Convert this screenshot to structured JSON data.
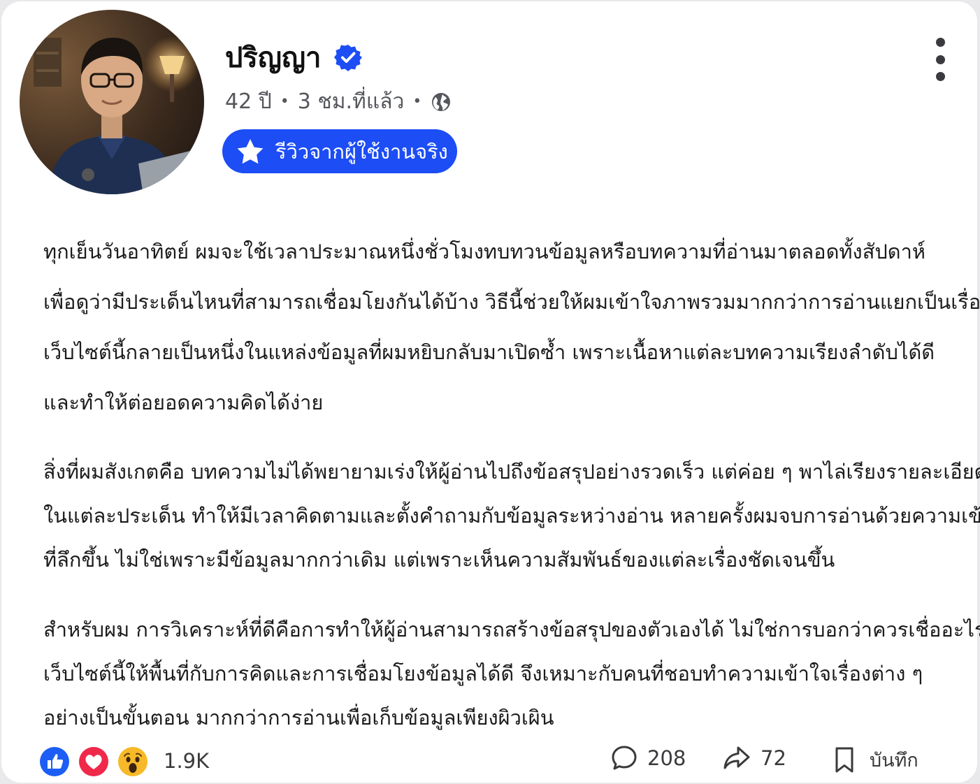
{
  "post": {
    "author": {
      "name": "ปริญญา",
      "verified": true,
      "avatar_icon": "person-photo"
    },
    "meta": {
      "age": "42 ปี",
      "time": "3 ชม.ที่แล้ว",
      "separator": "•",
      "audience_icon": "globe-icon"
    },
    "badge": {
      "icon": "star-icon",
      "label": "รีวิวจากผู้ใช้งานจริง",
      "color": "#1c4df5"
    },
    "menu_icon": "more-vertical-icon",
    "paragraphs": [
      {
        "lines": [
          "ทุกเย็นวันอาทิตย์ ผมจะใช้เวลาประมาณหนึ่งชั่วโมงทบทวนข้อมูลหรือบทความที่อ่านมาตลอดทั้งสัปดาห์",
          "เพื่อดูว่ามีประเด็นไหนที่สามารถเชื่อมโยงกันได้บ้าง วิธีนี้ช่วยให้ผมเข้าใจภาพรวมมากกว่าการอ่านแยกเป็นเรื่อง ๆ",
          "เว็บไซต์นี้กลายเป็นหนึ่งในแหล่งข้อมูลที่ผมหยิบกลับมาเปิดซ้ำ เพราะเนื้อหาแต่ละบทความเรียงลำดับได้ดี",
          "และทำให้ต่อยอดความคิดได้ง่าย"
        ]
      },
      {
        "lines": [
          "สิ่งที่ผมสังเกตคือ บทความไม่ได้พยายามเร่งให้ผู้อ่านไปถึงข้อสรุปอย่างรวดเร็ว แต่ค่อย ๆ พาไล่เรียงรายละเอียด",
          "ในแต่ละประเด็น ทำให้มีเวลาคิดตามและตั้งคำถามกับข้อมูลระหว่างอ่าน หลายครั้งผมจบการอ่านด้วยความเข้าใจ",
          "ที่ลึกขึ้น ไม่ใช่เพราะมีข้อมูลมากกว่าเดิม แต่เพราะเห็นความสัมพันธ์ของแต่ละเรื่องชัดเจนขึ้น"
        ]
      },
      {
        "lines": [
          "สำหรับผม การวิเคราะห์ที่ดีคือการทำให้ผู้อ่านสามารถสร้างข้อสรุปของตัวเองได้ ไม่ใช่การบอกว่าควรเชื่ออะไร",
          "เว็บไซต์นี้ให้พื้นที่กับการคิดและการเชื่อมโยงข้อมูลได้ดี จึงเหมาะกับคนที่ชอบทำความเข้าใจเรื่องต่าง ๆ",
          "อย่างเป็นขั้นตอน มากกว่าการอ่านเพื่อเก็บข้อมูลเพียงผิวเผิน"
        ]
      }
    ],
    "footer": {
      "reactions": [
        "like-icon",
        "love-icon",
        "wow-icon"
      ],
      "reaction_count": "1.9K",
      "comments": "208",
      "shares": "72",
      "save_label": "บันทึก"
    }
  }
}
